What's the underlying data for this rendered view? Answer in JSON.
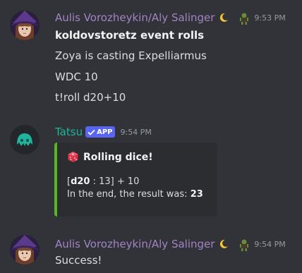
{
  "messages": [
    {
      "author": "Aulis Vorozheykin/Aly Salinger",
      "name_color": "#a184c6",
      "badges": [
        "crescent-moon-icon",
        "goblin-icon"
      ],
      "time": "9:53 PM",
      "lines": [
        {
          "text": "koldovstoretz event rolls",
          "bold": true
        },
        {
          "text": "Zoya is casting Expelliarmus"
        },
        {
          "text": "WDC 10"
        },
        {
          "text": "t!roll d20+10"
        }
      ]
    },
    {
      "author": "Tatsu",
      "name_color": "#1fb49b",
      "app_badge": "APP",
      "time": "9:54 PM",
      "embed": {
        "accent_color": "#56b81e",
        "icon": "dice-icon",
        "title": "Rolling dice!",
        "roll_open": "[",
        "roll_die": "d20",
        "roll_rest": " : 13] + 10",
        "result_prefix": "In the end, the result was: ",
        "result_value": "23"
      }
    },
    {
      "author": "Aulis Vorozheykin/Aly Salinger",
      "name_color": "#a184c6",
      "badges": [
        "crescent-moon-icon",
        "goblin-icon"
      ],
      "time": "9:54 PM",
      "lines": [
        {
          "text": "Success!"
        }
      ]
    }
  ]
}
